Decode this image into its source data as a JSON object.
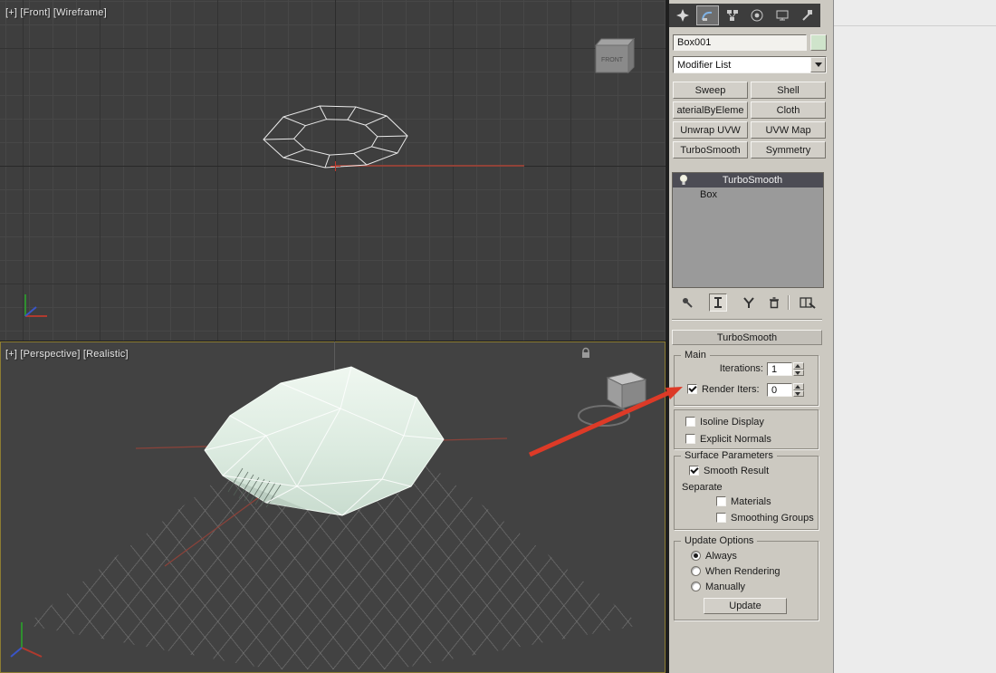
{
  "viewports": {
    "front": {
      "label": "[+] [Front] [Wireframe]",
      "viewcube_label": "FRONT"
    },
    "perspective": {
      "label": "[+] [Perspective] [Realistic]"
    }
  },
  "panel": {
    "object_name": "Box001",
    "modifier_list": "Modifier List",
    "modifier_buttons": [
      "Sweep",
      "Shell",
      "aterialByEleme",
      "Cloth",
      "Unwrap UVW",
      "UVW Map",
      "TurboSmooth",
      "Symmetry"
    ],
    "stack_items": [
      "TurboSmooth",
      "Box"
    ],
    "rollout_title": "TurboSmooth",
    "main_group": {
      "legend": "Main",
      "iterations_label": "Iterations:",
      "iterations_value": "1",
      "render_iters_label": "Render Iters:",
      "render_iters_value": "0",
      "render_iters_checked": true
    },
    "display_group": {
      "isoline_label": "Isoline Display",
      "isoline_checked": false,
      "explicit_label": "Explicit Normals",
      "explicit_checked": false
    },
    "surface_group": {
      "legend": "Surface Parameters",
      "smooth_result": "Smooth Result",
      "smooth_result_checked": true,
      "separate": "Separate",
      "materials": "Materials",
      "materials_checked": false,
      "smoothing_groups": "Smoothing Groups",
      "smoothing_groups_checked": false
    },
    "update_group": {
      "legend": "Update Options",
      "options": [
        "Always",
        "When Rendering",
        "Manually"
      ],
      "selected_option": "Always",
      "update_button": "Update"
    }
  },
  "icons": {
    "tabs": [
      "create",
      "modify",
      "hierarchy",
      "motion",
      "display",
      "utilities"
    ],
    "active_tab": "modify",
    "stack_tools": [
      "pin-stack",
      "show-end-result",
      "make-unique",
      "remove-modifier",
      "configure-modifier-sets"
    ],
    "stack_item_icon": "lightbulb",
    "dropdown": "chevron-down"
  },
  "colors": {
    "annotation_arrow": "#dd3a27",
    "object_color_swatch": "#cfe4cb",
    "viewport_background": "#3e3e3e",
    "panel_background": "#ccc9c1",
    "stack_selected": "#4c4c54",
    "object_fill": "#dcebe0",
    "active_viewport_border": "#8d7d33"
  }
}
